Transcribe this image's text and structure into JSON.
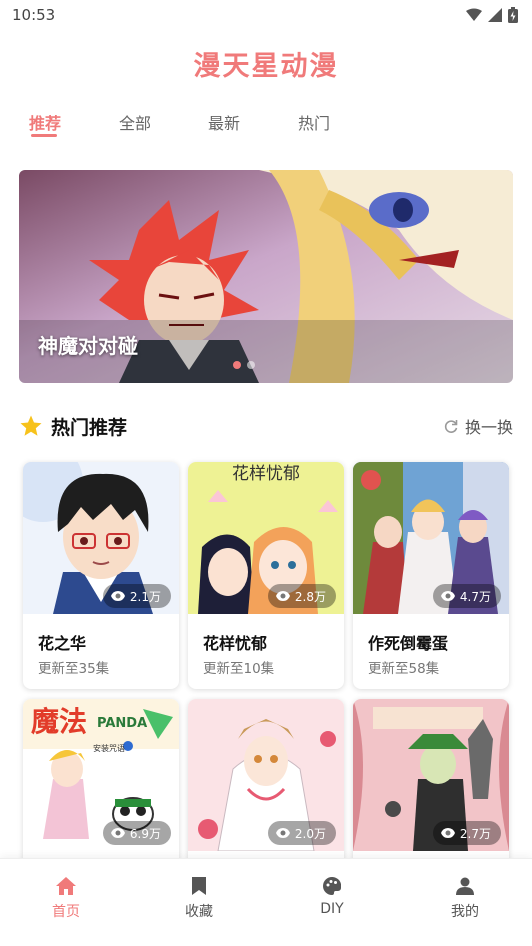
{
  "status_bar": {
    "time": "10:53"
  },
  "app": {
    "title": "漫天星动漫",
    "accent_color": "#f07a7a"
  },
  "tabs": [
    {
      "label": "推荐",
      "active": true
    },
    {
      "label": "全部",
      "active": false
    },
    {
      "label": "最新",
      "active": false
    },
    {
      "label": "热门",
      "active": false
    }
  ],
  "banner": {
    "title": "神魔对对碰",
    "slide_count": 2,
    "active_slide": 1
  },
  "section": {
    "title": "热门推荐",
    "icon": "star-icon",
    "refresh_label": "换一换",
    "refresh_icon": "refresh-icon"
  },
  "cards": [
    {
      "title": "花之华",
      "subtitle": "更新至35集",
      "views": "2.1万"
    },
    {
      "title": "花样忧郁",
      "subtitle": "更新至10集",
      "views": "2.8万",
      "cover_text": "花样忧郁"
    },
    {
      "title": "作死倒霉蛋",
      "subtitle": "更新至58集",
      "views": "4.7万"
    },
    {
      "title": "",
      "subtitle": "",
      "views": "6.9万",
      "cover_text": "魔法",
      "cover_subtext": "PANDA",
      "cover_caption": "安装咒语"
    },
    {
      "title": "",
      "subtitle": "",
      "views": "2.0万"
    },
    {
      "title": "",
      "subtitle": "",
      "views": "2.7万"
    }
  ],
  "bottom_nav": [
    {
      "label": "首页",
      "icon": "home-icon",
      "active": true
    },
    {
      "label": "收藏",
      "icon": "bookmark-icon",
      "active": false
    },
    {
      "label": "DIY",
      "icon": "palette-icon",
      "active": false
    },
    {
      "label": "我的",
      "icon": "user-icon",
      "active": false
    }
  ]
}
